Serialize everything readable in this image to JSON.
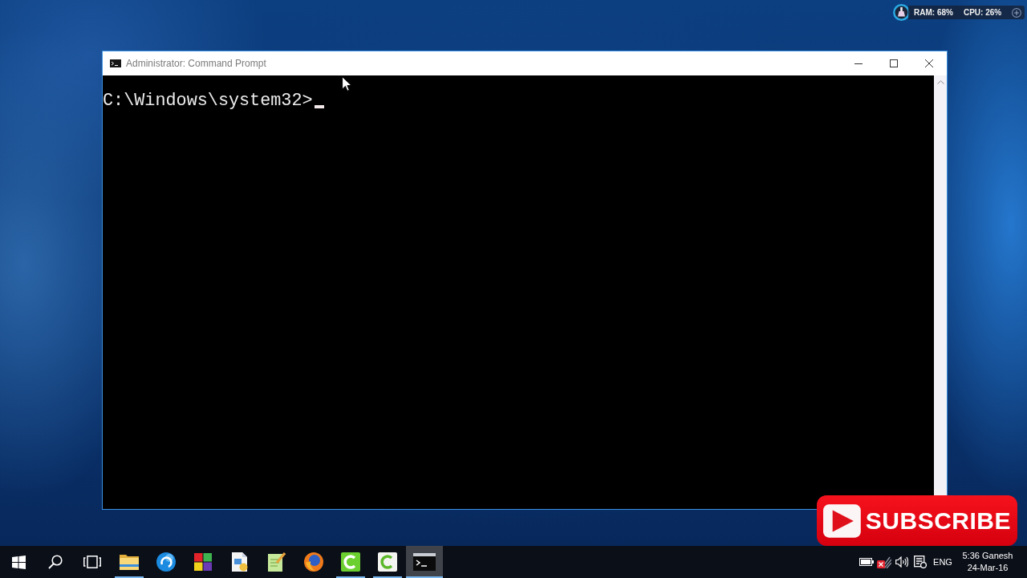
{
  "desktop_widget": {
    "ram": "RAM: 68%",
    "cpu": "CPU: 26%"
  },
  "window": {
    "title": "Administrator: Command Prompt",
    "console_lines": [
      "C:\\Windows\\system32>"
    ],
    "cursor": true
  },
  "subscribe_button": {
    "label": "SUBSCRIBE"
  },
  "taskbar": {
    "buttons": [
      {
        "kind": "start"
      },
      {
        "kind": "search"
      },
      {
        "kind": "taskview"
      }
    ],
    "apps": [
      {
        "kind": "folder",
        "running": true,
        "selected": false
      },
      {
        "kind": "swirl",
        "running": false,
        "selected": false
      },
      {
        "kind": "tiles",
        "running": false,
        "selected": false
      },
      {
        "kind": "document",
        "running": false,
        "selected": false
      },
      {
        "kind": "notepad",
        "running": false,
        "selected": false
      },
      {
        "kind": "globe",
        "running": false,
        "selected": false
      },
      {
        "kind": "arcsolid",
        "running": true,
        "selected": false
      },
      {
        "kind": "arclight",
        "running": true,
        "selected": false
      },
      {
        "kind": "console",
        "running": true,
        "selected": true
      }
    ],
    "tray": {
      "network_connected": false,
      "language": "ENG",
      "time": "5:36 Ganesh",
      "date": "24-Mar-16"
    }
  }
}
